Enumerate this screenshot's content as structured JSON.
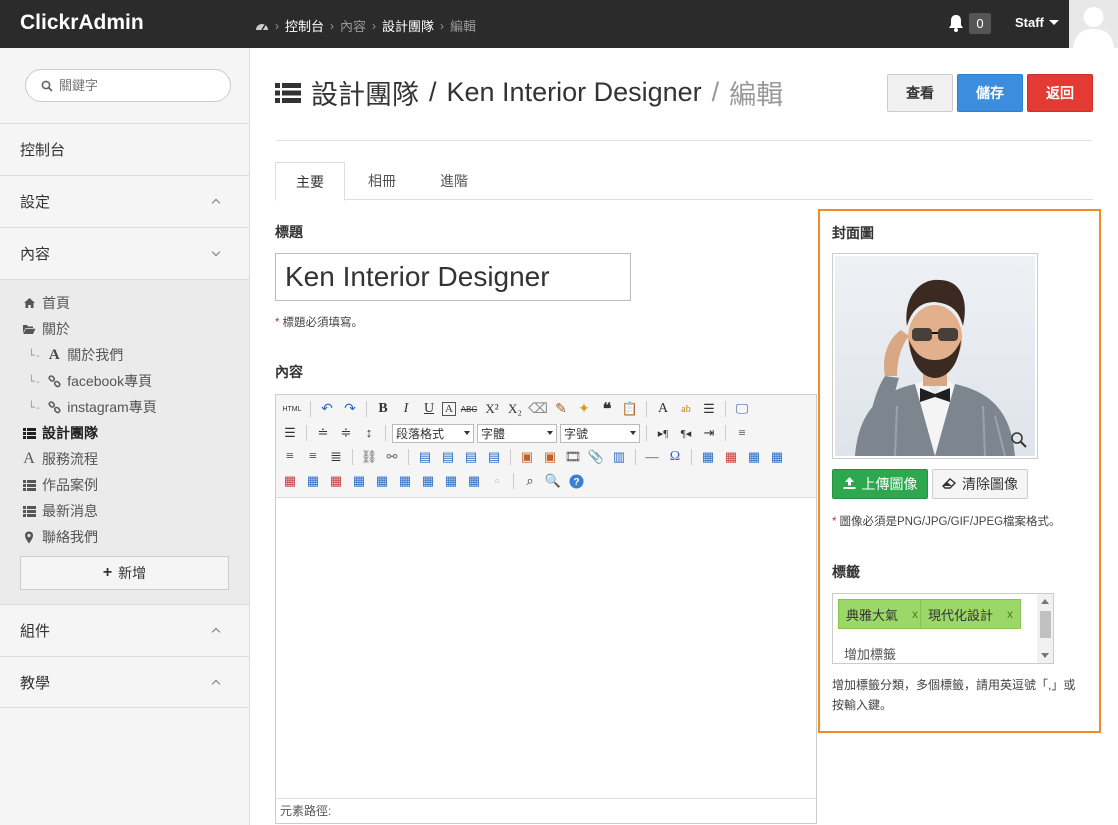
{
  "app": {
    "brand": "ClickrAdmin"
  },
  "breadcrumb": [
    "控制台",
    "內容",
    "設計團隊",
    "編輯"
  ],
  "header": {
    "notification_count": "0",
    "user": "Staff"
  },
  "sidebar": {
    "search_placeholder": "關鍵字",
    "sections": [
      {
        "label": "控制台"
      },
      {
        "label": "設定"
      },
      {
        "label": "內容"
      },
      {
        "label": "組件"
      },
      {
        "label": "教學"
      }
    ],
    "content_items": [
      {
        "label": "首頁",
        "icon": "home-icon"
      },
      {
        "label": "關於",
        "icon": "folder-open-icon"
      },
      {
        "label": "關於我們",
        "icon": "font-icon"
      },
      {
        "label": "facebook專頁",
        "icon": "link-icon"
      },
      {
        "label": "instagram專頁",
        "icon": "link-icon"
      },
      {
        "label": "設計團隊",
        "icon": "list-icon"
      },
      {
        "label": "服務流程",
        "icon": "font-icon"
      },
      {
        "label": "作品案例",
        "icon": "list-icon"
      },
      {
        "label": "最新消息",
        "icon": "list-icon"
      },
      {
        "label": "聯絡我們",
        "icon": "map-marker-icon"
      }
    ],
    "add_label": "新增"
  },
  "page": {
    "title_section": "設計團隊",
    "title_item": "Ken Interior Designer",
    "title_mode": "編輯",
    "slash": "/",
    "buttons": {
      "view": "查看",
      "save": "儲存",
      "back": "返回"
    }
  },
  "tabs": [
    "主要",
    "相冊",
    "進階"
  ],
  "form": {
    "title_label": "標題",
    "title_value": "Ken Interior Designer",
    "title_note": "標題必須填寫。",
    "content_label": "內容",
    "editor": {
      "html_label": "HTML",
      "format_select": "段落格式",
      "font_select": "字體",
      "size_select": "字號",
      "path_label": "元素路徑:"
    }
  },
  "cover": {
    "label": "封面圖",
    "upload_label": "上傳圖像",
    "clear_label": "清除圖像",
    "note": "圖像必須是PNG/JPG/GIF/JPEG檔案格式。"
  },
  "tags": {
    "label": "標籤",
    "items": [
      "典雅大氣",
      "現代化設計"
    ],
    "remove_mark": "x",
    "input_placeholder": "增加標籤",
    "help": "增加標籤分類，多個標籤，請用英逗號「,」或按輸入鍵。"
  },
  "colors": {
    "topbar": "#2b2b2b",
    "save": "#3c8dde",
    "back": "#e33b33",
    "upload": "#2ea84f",
    "tag": "#9cd867",
    "highlight": "#f08a2c"
  }
}
